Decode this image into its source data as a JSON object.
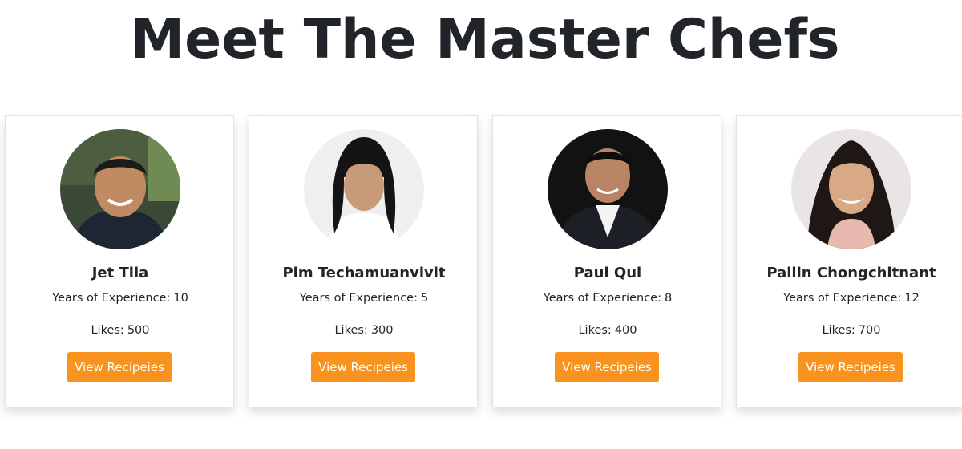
{
  "page": {
    "title": "Meet The Master Chefs"
  },
  "labels": {
    "experience": "Years of Experience:",
    "likes": "Likes:"
  },
  "chefs": [
    {
      "name": "Jet Tila",
      "experience": "10",
      "likes": "500",
      "button_label": "View Recipeies",
      "photo": "chef-jet-tila-photo"
    },
    {
      "name": "Pim Techamuanvivit",
      "experience": "5",
      "likes": "300",
      "button_label": "View Recipeies",
      "photo": "chef-pim-techamuanvivit-photo"
    },
    {
      "name": "Paul Qui",
      "experience": "8",
      "likes": "400",
      "button_label": "View Recipeies",
      "photo": "chef-paul-qui-photo"
    },
    {
      "name": "Pailin Chongchitnant",
      "experience": "12",
      "likes": "700",
      "button_label": "View Recipeies",
      "photo": "chef-pailin-chongchitnant-photo"
    }
  ],
  "colors": {
    "button_background": "#f7931e",
    "button_text": "#ffffff",
    "heading": "#212529",
    "card_border": "#e2e2e2"
  }
}
